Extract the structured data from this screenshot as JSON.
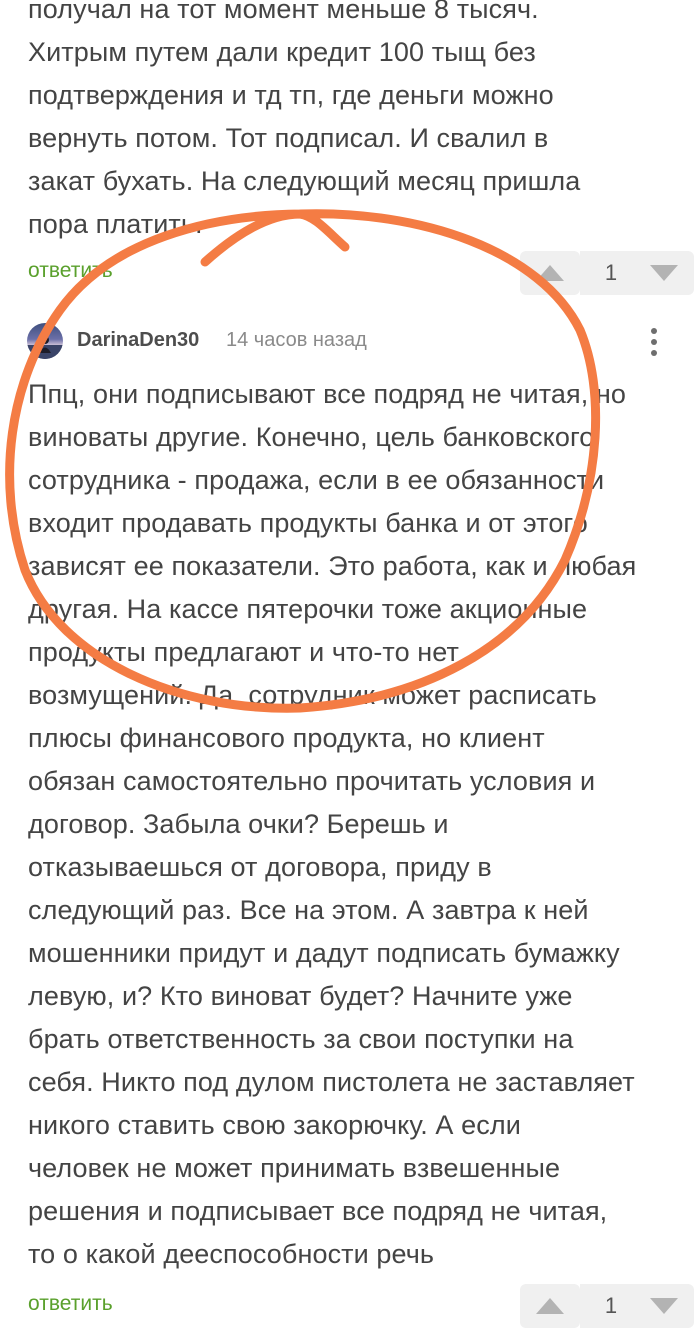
{
  "previous_comment": {
    "lines": [
      "получал на тот момент меньше 8 тысяч.",
      "Хитрым путем дали кредит 100 тыщ без",
      "подтверждения и тд тп, где деньги можно",
      "вернуть потом. Тот подписал. И свалил в",
      "закат бухать. На следующий месяц пришла",
      "пора платить."
    ],
    "reply_label": "ответить",
    "score": "1"
  },
  "comment": {
    "author": "DarinaDen30",
    "time_ago": "14 часов назад",
    "lines": [
      "Ппц, они подписывают все подряд не читая, но",
      "виноваты другие. Конечно, цель банковского",
      "сотрудника - продажа, если в ее обязанности",
      "входит продавать продукты банка и от этого",
      "зависят ее показатели. Это работа, как и любая",
      "другая. На кассе пятерочки тоже акционные",
      "продукты предлагают и что-то нет",
      "возмущений. Да, сотрудник может расписать",
      "плюсы финансового продукта, но клиент",
      "обязан самостоятельно прочитать условия и",
      "договор. Забыла очки? Берешь и",
      "отказываешься от договора, приду в",
      "следующий раз. Все на этом. А завтра к ней",
      "мошенники придут и дадут подписать бумажку",
      "левую, и? Кто виноват будет? Начните уже",
      "брать ответственность за свои поступки на",
      "себя. Никто под дулом пистолета не заставляет",
      "никого ставить свою закорючку. А если",
      "человек не может принимать взвешенные",
      "решения и подписывает все подряд не читая,",
      "то о какой дееспособности речь"
    ],
    "reply_label": "ответить",
    "score": "1"
  },
  "icons": {
    "upvote": "upvote-arrow-icon",
    "downvote": "downvote-arrow-icon",
    "more": "more-vertical-icon",
    "avatar": "user-avatar"
  },
  "colors": {
    "reply_link": "#5aa02c",
    "annotation_stroke": "#f47c44",
    "vote_bg": "#f0f0f0",
    "vote_arrow": "#b3b3b3"
  }
}
